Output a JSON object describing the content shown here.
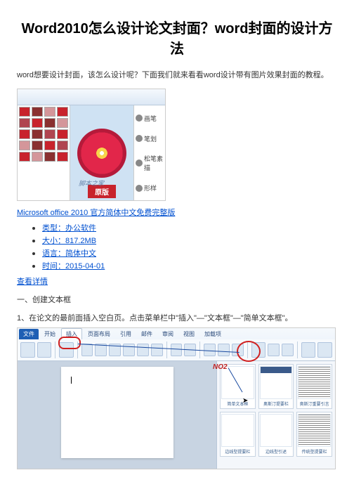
{
  "title": "Word2010怎么设计论文封面？word封面的设计方法",
  "intro": "word想要设计封面，该怎么设计呢？下面我们就来看看word设计带有图片效果封面的教程。",
  "img1": {
    "side_labels": [
      "画笔",
      "笔划",
      "松笔素描",
      "形样"
    ],
    "origin_label": "原版",
    "watermark": "脚本之家"
  },
  "download_link": "Microsoft office 2010 官方简体中文免费完整版",
  "meta": {
    "type_label": "类型：",
    "type_value": "办公软件",
    "size_label": "大小：",
    "size_value": "817.2MB",
    "lang_label": "语言：",
    "lang_value": "简体中文",
    "time_label": "时间：",
    "time_value": "2015-04-01"
  },
  "detail_link": "查看详情",
  "section1": "一、创建文本框",
  "step1": "1、在论文的最前面插入空白页。点击菜单栏中\"插入\"—\"文本框\"—\"简单文本框\"。",
  "img2": {
    "tabs": [
      "文件",
      "开始",
      "插入",
      "页面布局",
      "引用",
      "邮件",
      "审阅",
      "视图",
      "加载项"
    ],
    "no2_label": "NO2",
    "dropdown_options": [
      "简单文本框",
      "奥斯汀提要栏",
      "奥斯汀重要引言",
      "边线型提要栏",
      "边线型引述",
      "传统型提要栏"
    ]
  }
}
